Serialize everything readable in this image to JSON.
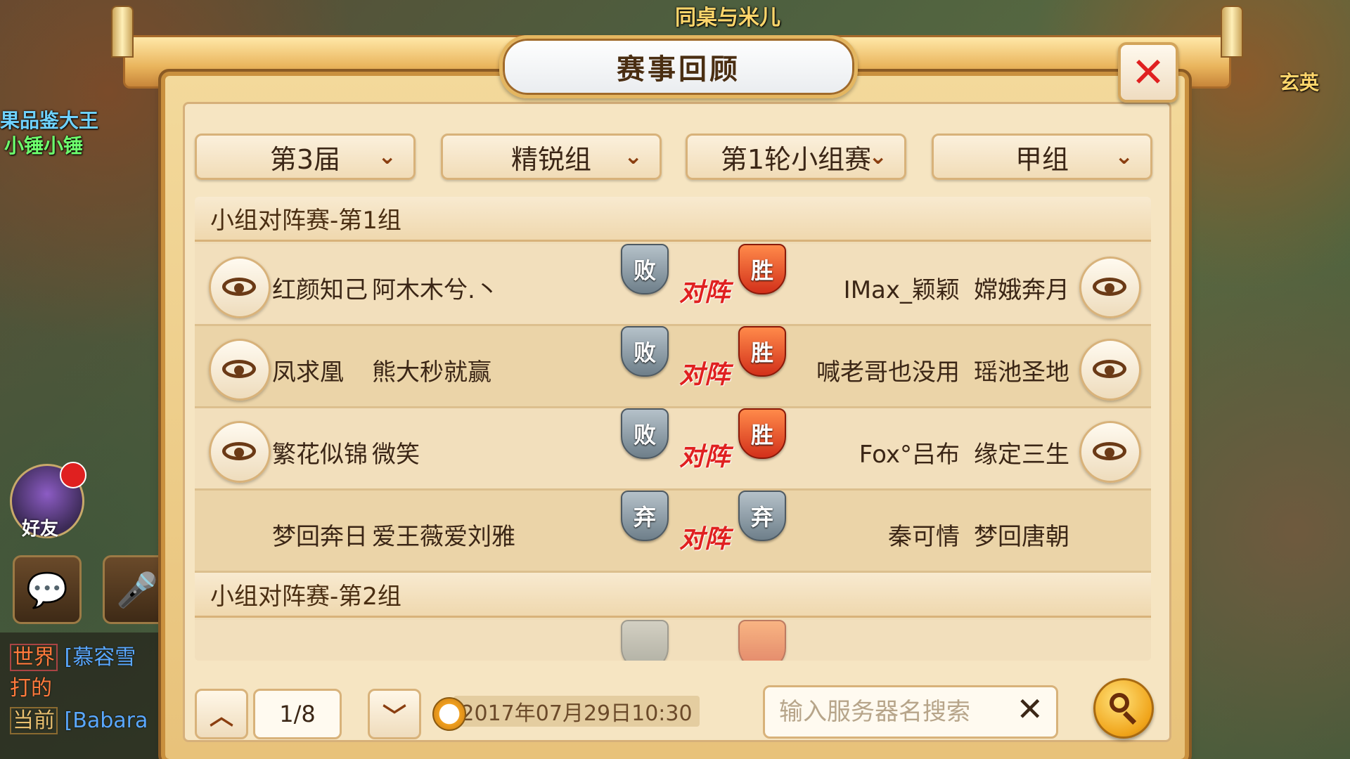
{
  "background": {
    "guild_text": "果品鉴大王",
    "player_name": "小锤小锤",
    "top_text": "同桌与米儿",
    "right_text": "玄英",
    "friend_label": "好友",
    "chat": [
      {
        "tag": "世界",
        "text": "[慕容雪"
      },
      {
        "tag": "",
        "text": "打的"
      },
      {
        "tag": "当前",
        "text": "[Babara"
      }
    ]
  },
  "dialog": {
    "title": "赛事回顾",
    "close_icon": "close-icon",
    "filters": [
      {
        "label": "第3届"
      },
      {
        "label": "精锐组"
      },
      {
        "label": "第1轮小组赛"
      },
      {
        "label": "甲组"
      }
    ],
    "groups": [
      {
        "header": "小组对阵赛-第1组",
        "matches": [
          {
            "left_server": "红颜知己",
            "left_player": "阿木木兮.丶",
            "left_result": "败",
            "vs": "对阵",
            "right_result": "胜",
            "right_player": "IMax_颖颖",
            "right_server": "嫦娥奔月",
            "has_replay": true
          },
          {
            "left_server": "凤求凰",
            "left_player": "熊大秒就赢",
            "left_result": "败",
            "vs": "对阵",
            "right_result": "胜",
            "right_player": "喊老哥也没用",
            "right_server": "瑶池圣地",
            "has_replay": true
          },
          {
            "left_server": "繁花似锦",
            "left_player": "微笑",
            "left_result": "败",
            "vs": "对阵",
            "right_result": "胜",
            "right_player": "Fox°吕布",
            "right_server": "缘定三生",
            "has_replay": true
          },
          {
            "left_server": "梦回奔日",
            "left_player": "爱王薇爱刘雅",
            "left_result": "弃",
            "vs": "对阵",
            "right_result": "弃",
            "right_player": "秦可情",
            "right_server": "梦回唐朝",
            "has_replay": false
          }
        ]
      },
      {
        "header": "小组对阵赛-第2组",
        "matches": []
      }
    ],
    "pagination": {
      "current": "1/8"
    },
    "date": "2017年07月29日10:30",
    "search": {
      "placeholder": "输入服务器名搜索",
      "value": ""
    }
  }
}
